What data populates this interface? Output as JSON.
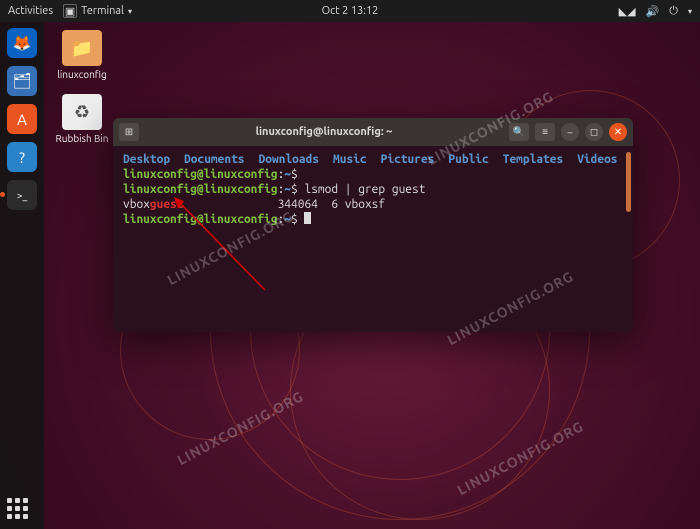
{
  "topbar": {
    "activities": "Activities",
    "app_label": "Terminal",
    "clock": "Oct 2  13:12"
  },
  "dock": {
    "items": [
      {
        "name": "firefox-icon",
        "bg": "#0a63c2",
        "glyph": "🦊"
      },
      {
        "name": "files-icon",
        "bg": "#3670b7",
        "glyph": "🗂"
      },
      {
        "name": "software-icon",
        "bg": "#e95420",
        "glyph": "A"
      },
      {
        "name": "help-icon",
        "bg": "#2a82c9",
        "glyph": "?"
      },
      {
        "name": "terminal-icon",
        "bg": "#2b2b2b",
        "glyph": ">_"
      }
    ]
  },
  "desktop": {
    "folder_label": "linuxconfig",
    "trash_label": "Rubbish Bin"
  },
  "terminal": {
    "title": "linuxconfig@linuxconfig: ~",
    "ls": [
      "Desktop",
      "Documents",
      "Downloads",
      "Music",
      "Pictures",
      "Public",
      "Templates",
      "Videos"
    ],
    "prompt_user": "linuxconfig@linuxconfig",
    "prompt_path": "~",
    "cmd1": "",
    "cmd2": "lsmod | grep guest",
    "out_pre": "vbox",
    "out_hl": "guest",
    "out_rest": "              344064  6 vboxsf"
  },
  "watermark": "LINUXCONFIG.ORG"
}
